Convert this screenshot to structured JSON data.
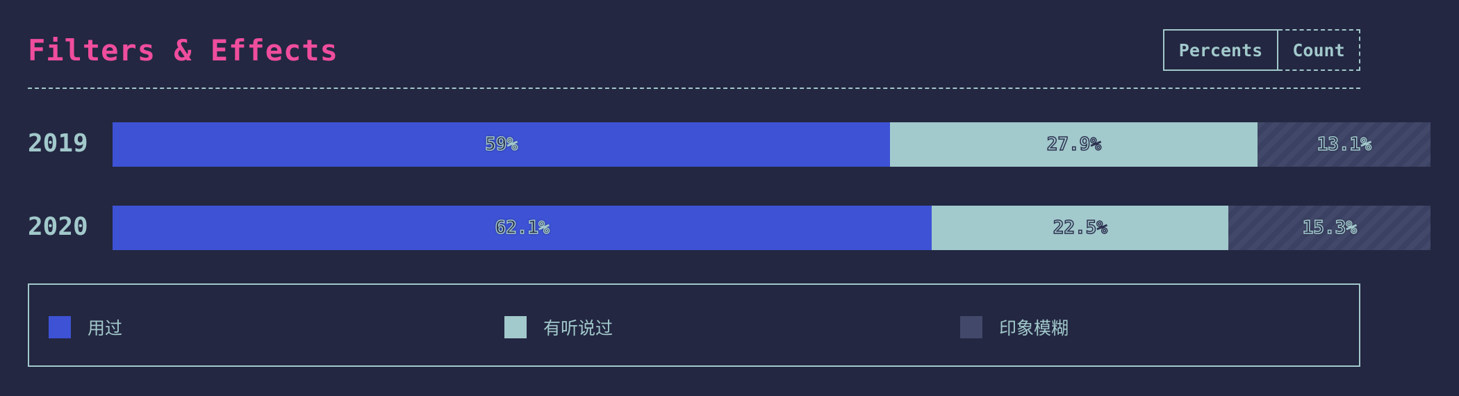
{
  "header": {
    "title": "Filters & Effects",
    "toggle_percents": "Percents",
    "toggle_count": "Count"
  },
  "chart_data": {
    "type": "bar",
    "stacked": true,
    "orientation": "horizontal",
    "normalized": true,
    "categories": [
      "2019",
      "2020"
    ],
    "series": [
      {
        "name": "用过",
        "values": [
          59,
          62.1
        ],
        "labels": [
          "59%",
          "62.1%"
        ],
        "color": "#3d52d5"
      },
      {
        "name": "有听说过",
        "values": [
          27.9,
          22.5
        ],
        "labels": [
          "27.9%",
          "22.5%"
        ],
        "color": "#a2c9cc"
      },
      {
        "name": "印象模糊",
        "values": [
          13.1,
          15.3
        ],
        "labels": [
          "13.1%",
          "15.3%"
        ],
        "color": "#424869"
      }
    ],
    "legend_position": "bottom"
  },
  "colors": {
    "background": "#232741",
    "title": "#ef4d9d",
    "text": "#a2c9cc"
  }
}
